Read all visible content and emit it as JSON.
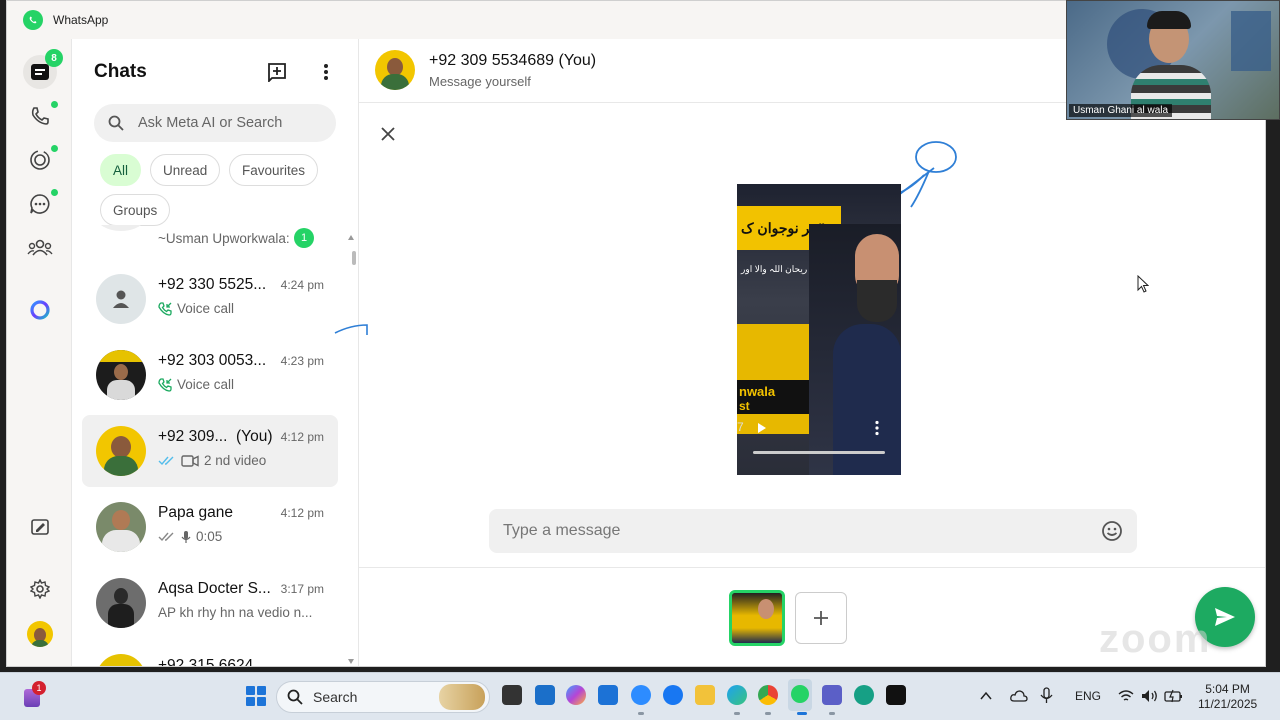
{
  "window": {
    "title": "WhatsApp"
  },
  "rail": {
    "chats_badge": "8"
  },
  "chatlist": {
    "title": "Chats",
    "search_placeholder": "Ask Meta AI or Search",
    "filters": [
      "All",
      "Unread",
      "Favourites",
      "Groups"
    ],
    "partial_row": {
      "subtitle": "~Usman Upworkwala:",
      "unread": "1"
    },
    "rows": [
      {
        "name": "+92 330 5525...",
        "time": "4:24 pm",
        "subtitle": "Voice call"
      },
      {
        "name": "+92 303 0053...",
        "time": "4:23 pm",
        "subtitle": "Voice call"
      },
      {
        "name": "+92 309...",
        "you": "(You)",
        "time": "4:12 pm",
        "subtitle": "2 nd video"
      },
      {
        "name": "Papa gane",
        "time": "4:12 pm",
        "subtitle": "0:05"
      },
      {
        "name": "Aqsa Docter S...",
        "time": "3:17 pm",
        "subtitle": "AP kh rhy hn na vedio n..."
      }
    ],
    "bottom_row_partial": "+92 315 6624"
  },
  "main": {
    "contact_name": "+92 309 5534689 (You)",
    "contact_subtitle": "Message yourself",
    "caption_placeholder": "Type a message",
    "video_text": {
      "urdu_line1": "\"ہر نوجوان ک",
      "urdu_line2": "ریحان اللہ والا اور",
      "banner": "nwala",
      "banner2": "st",
      "num": "7"
    },
    "watermark": "zoom"
  },
  "zoom_tile": {
    "name": "Usman Ghani al wala"
  },
  "taskbar": {
    "search_label": "Search",
    "lang": "ENG",
    "time": "5:04 PM",
    "date": "11/21/2025",
    "notification_badge": "1"
  },
  "colors": {
    "accent": "#25d366",
    "send": "#1daa61",
    "chip_active_bg": "#d9fdd3"
  }
}
